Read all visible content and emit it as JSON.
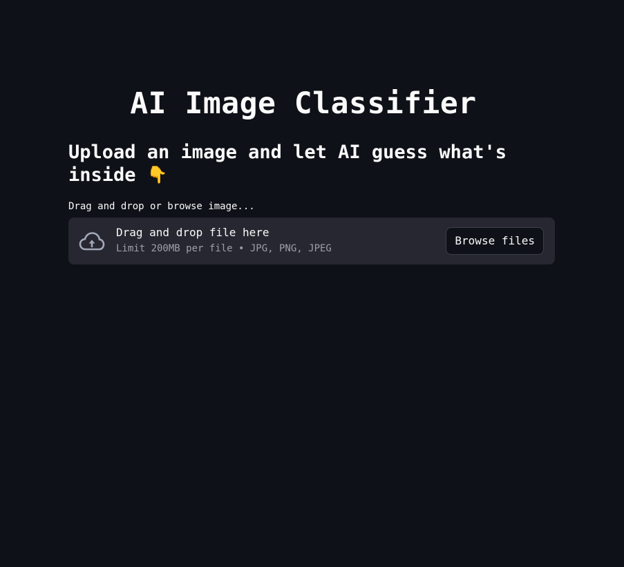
{
  "header": {
    "title": "AI Image Classifier",
    "subtitle": "Upload an image and let AI guess what's inside",
    "subtitle_emoji": "👇"
  },
  "uploader": {
    "label": "Drag and drop or browse image...",
    "dropzone_title": "Drag and drop file here",
    "dropzone_limit": "Limit 200MB per file • JPG, PNG, JPEG",
    "browse_label": "Browse files",
    "icon": "cloud-upload-icon"
  },
  "colors": {
    "background": "#0e1117",
    "dropzone": "#262730",
    "text": "#fafafa",
    "muted": "#9ea0a8"
  }
}
